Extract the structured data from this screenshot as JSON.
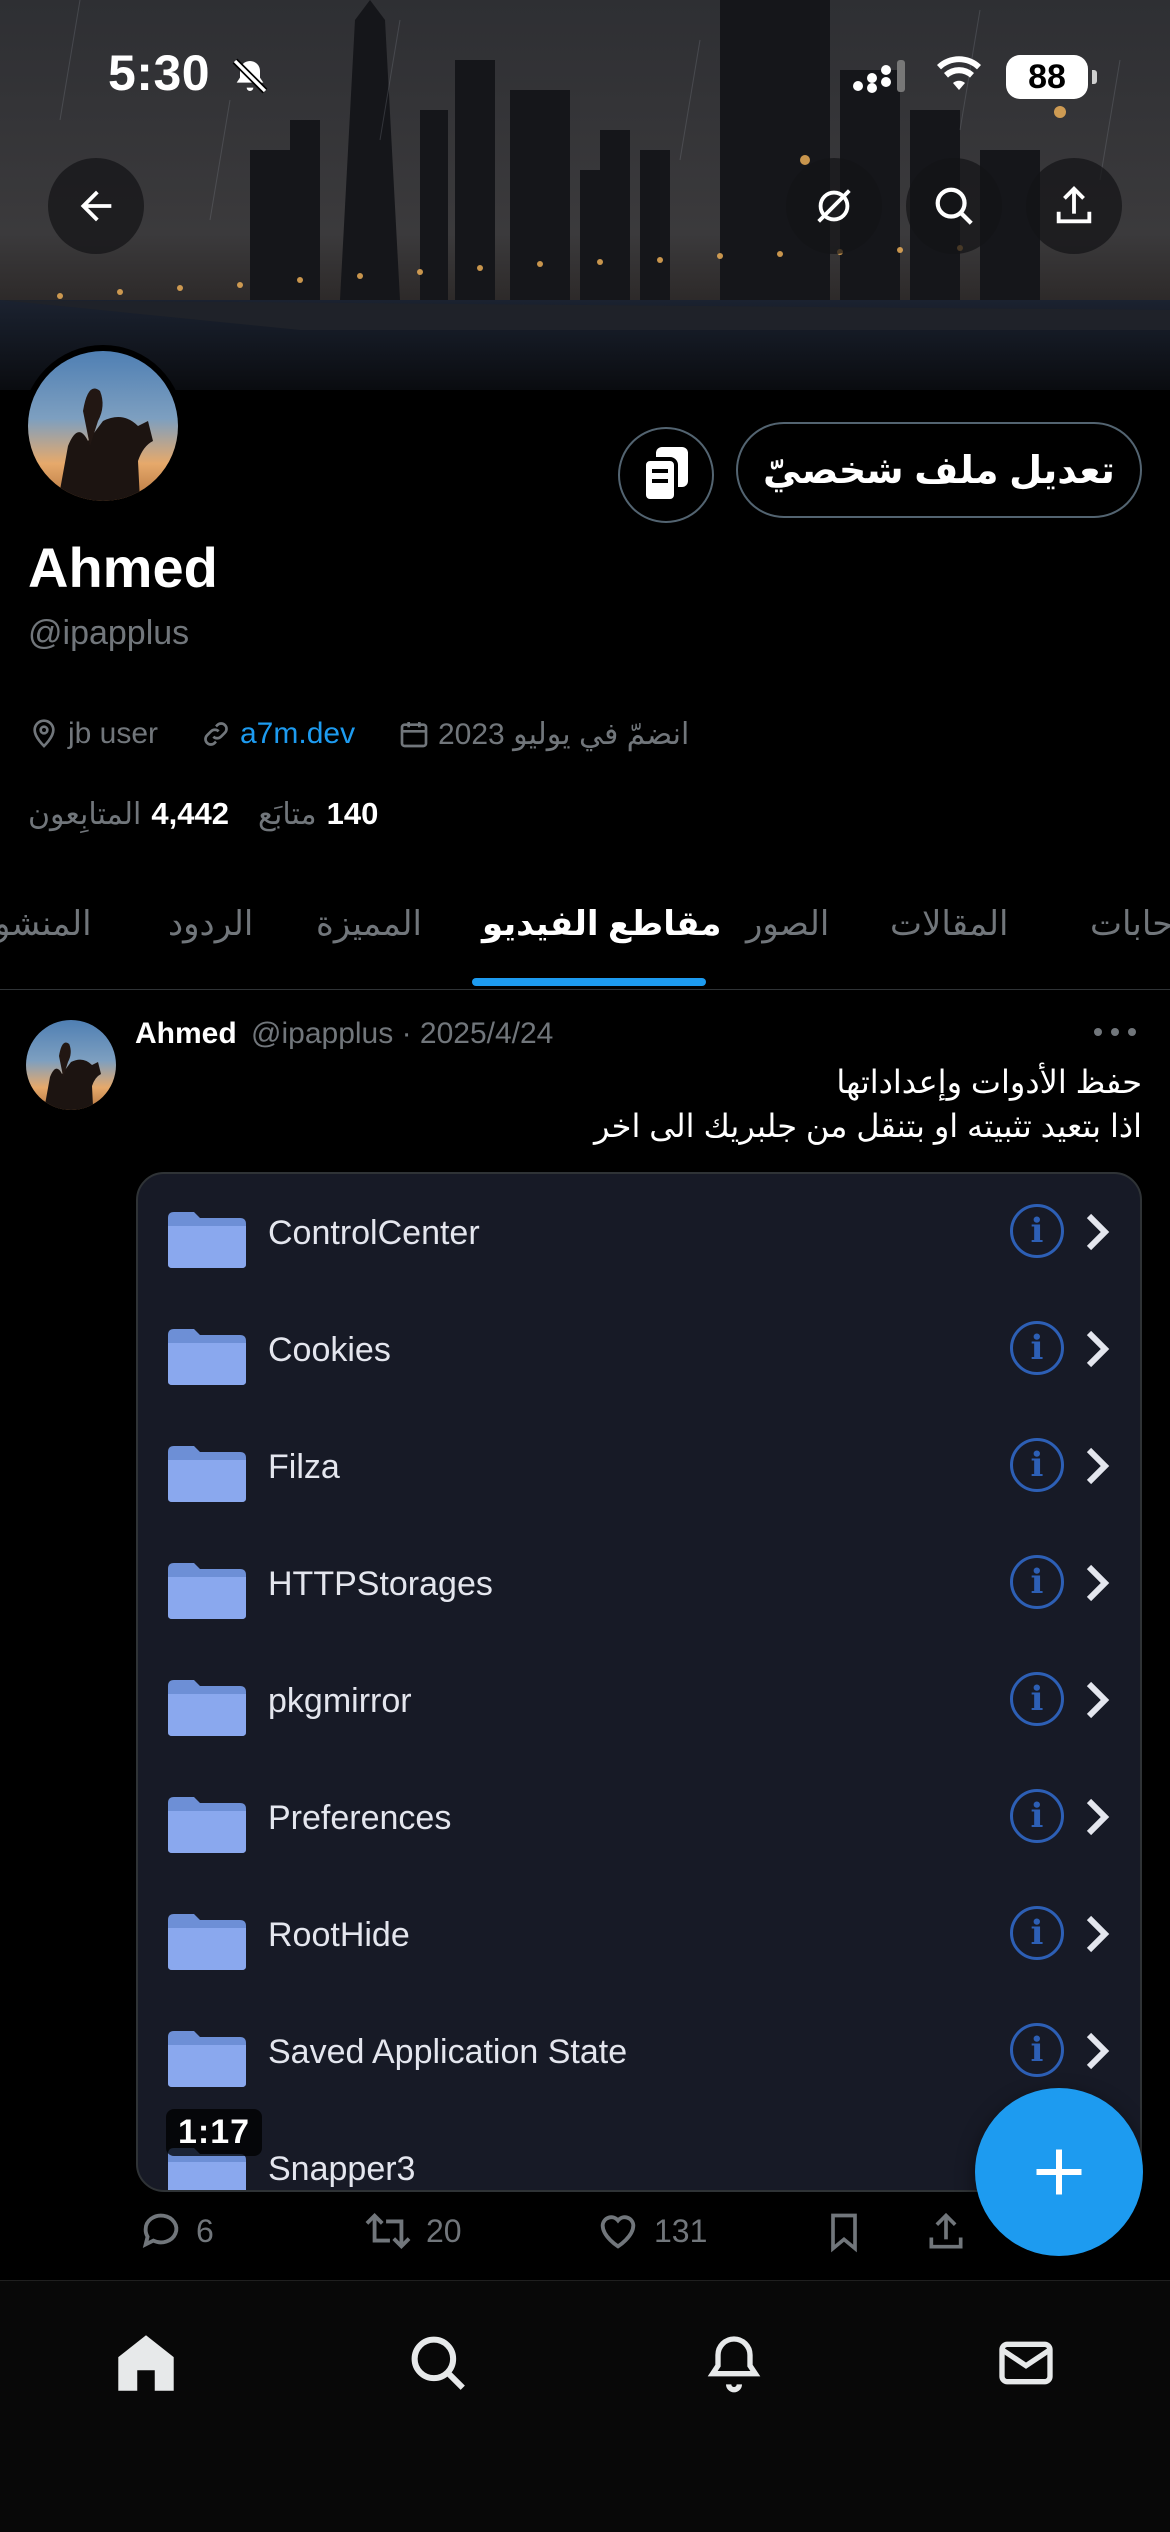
{
  "status_bar": {
    "time": "5:30",
    "battery": "88"
  },
  "profile": {
    "name": "Ahmed",
    "handle": "@ipapplus",
    "edit_button": "تعديل ملف شخصيّ",
    "location": "jb user",
    "website": "a7m.dev",
    "joined": "انضمّ في يوليو 2023",
    "followers_count": "4,442",
    "followers_label": "المتابِعون",
    "following_count": "140",
    "following_label": "متابَع"
  },
  "tabs": [
    {
      "label": "المنشو"
    },
    {
      "label": "الردود"
    },
    {
      "label": "المميزة"
    },
    {
      "label": "مقاطع الفيديو",
      "active": true
    },
    {
      "label": "الصور"
    },
    {
      "label": "المقالات"
    },
    {
      "label": "حابات"
    }
  ],
  "tweet": {
    "author": "Ahmed",
    "handle_date": "@ipapplus · 2025/4/24",
    "line1": "حفظ الأدوات وإعداداتها",
    "line2": "اذا بتعيد تثبيته او بتنقل من جلبريك الى اخر",
    "video": {
      "duration": "1:17",
      "folders": [
        "ControlCenter",
        "Cookies",
        "Filza",
        "HTTPStorages",
        "pkgmirror",
        "Preferences",
        "RootHide",
        "Saved Application State",
        "Snapper3"
      ]
    },
    "replies": "6",
    "retweets": "20",
    "likes": "131"
  },
  "colors": {
    "accent": "#1d9bf0",
    "muted": "#71767b",
    "background": "#000000"
  }
}
